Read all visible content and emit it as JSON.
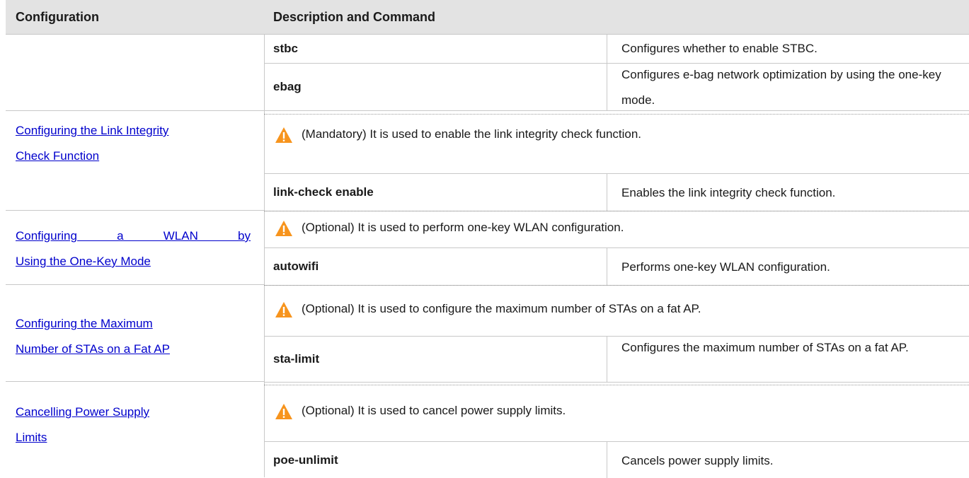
{
  "header": {
    "col1": "Configuration",
    "col2": "Description and Command"
  },
  "group1": {
    "rows": [
      {
        "command": "stbc",
        "description": "Configures whether to enable STBC."
      },
      {
        "command": "ebag",
        "description": "Configures e-bag network optimization by using the one-key mode."
      }
    ]
  },
  "sections": [
    {
      "link_line1": "Configuring the Link Integrity",
      "link_line2": "Check Function",
      "note": "(Mandatory) It is used to enable the link integrity check function.",
      "command": "link-check enable",
      "description": "Enables the link integrity check function."
    },
    {
      "link_line1": "Configuring a WLAN by",
      "link_line2": "Using the One-Key Mode",
      "note": "(Optional) It is used to perform one-key WLAN configuration.",
      "command": "autowifi",
      "description": "Performs one-key WLAN configuration."
    },
    {
      "link_line1": "Configuring the Maximum",
      "link_line2": "Number of STAs on a Fat AP",
      "note": "(Optional) It is used to configure the maximum number of STAs on a fat AP.",
      "command": "sta-limit",
      "description": "Configures the maximum number of STAs on a fat AP."
    },
    {
      "link_line1": "Cancelling Power Supply",
      "link_line2": "Limits",
      "note": "(Optional) It is used to cancel power supply limits.",
      "command": "poe-unlimit",
      "description": "Cancels power supply limits."
    }
  ],
  "icons": {
    "note": "warning-triangle-icon",
    "warning_color": "#f7941d"
  }
}
